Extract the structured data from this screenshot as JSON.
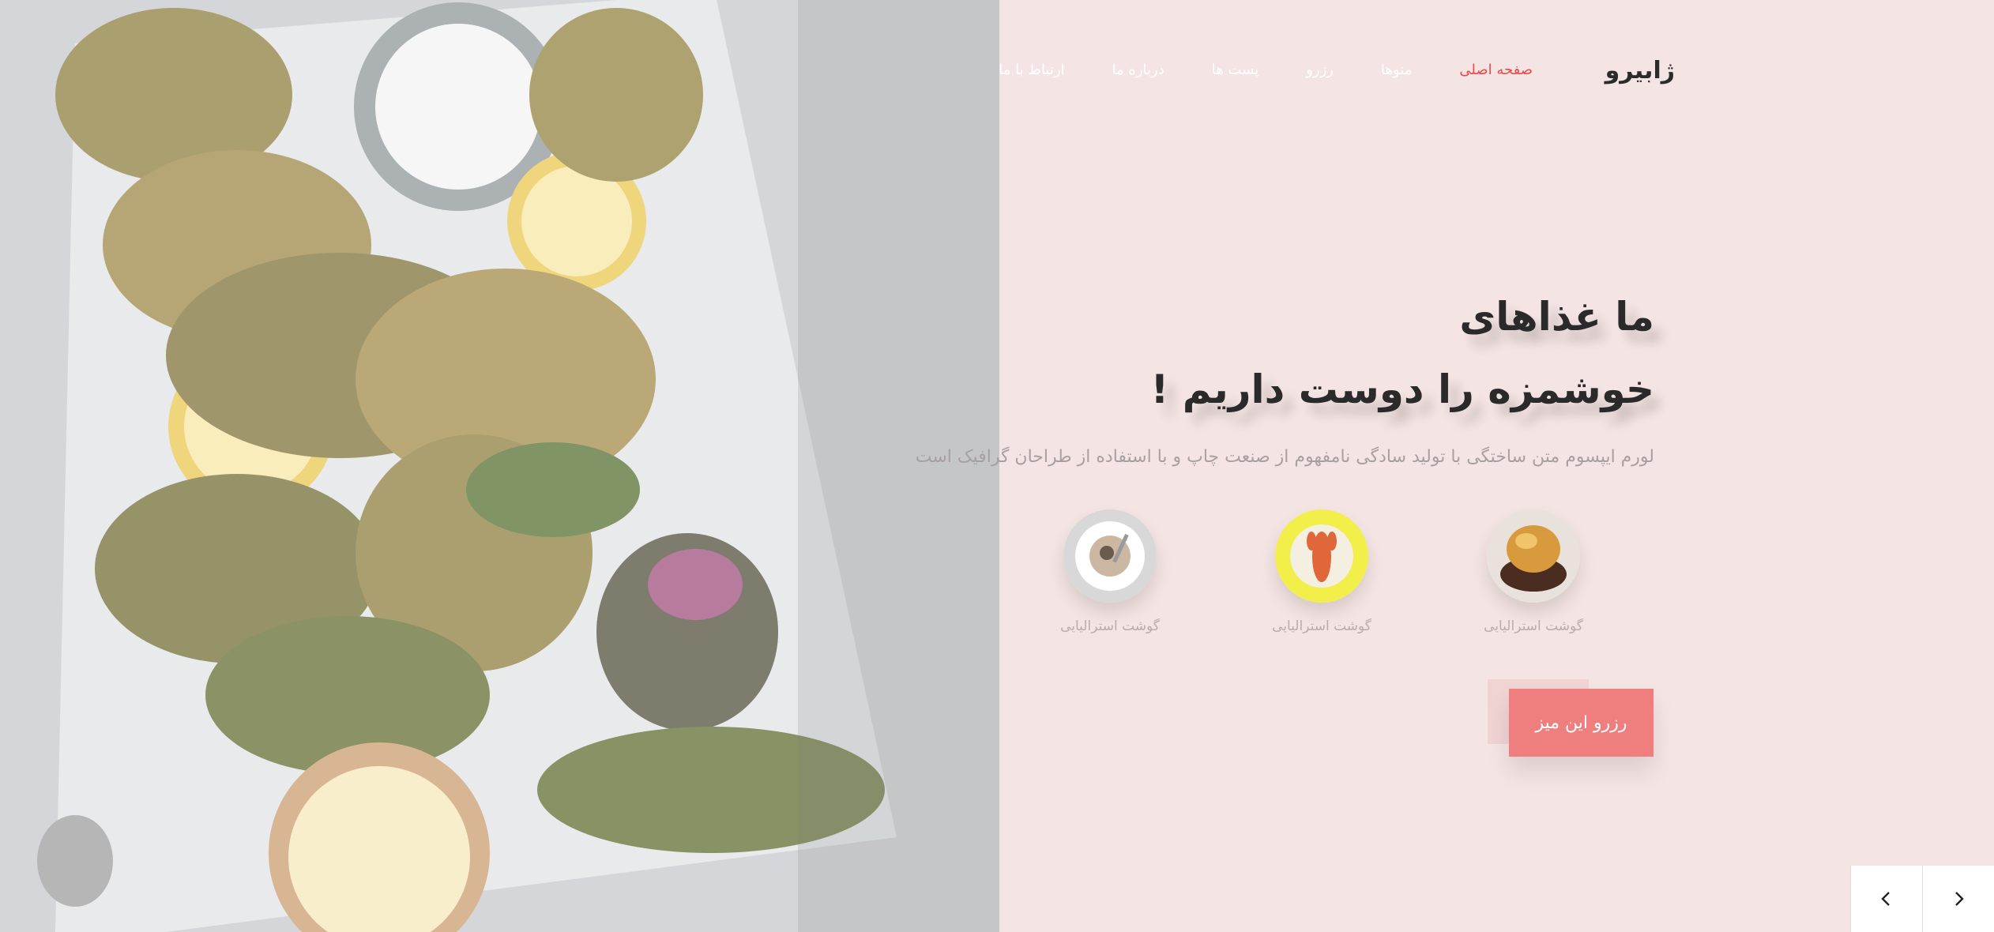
{
  "brand": {
    "logo": "ژابیرو"
  },
  "nav": {
    "items": [
      {
        "label": "صفحه اصلی",
        "active": true
      },
      {
        "label": "منوها",
        "active": false
      },
      {
        "label": "رزرو",
        "active": false
      },
      {
        "label": "پست ها",
        "active": false
      },
      {
        "label": "درباره ما",
        "active": false
      },
      {
        "label": "ارتباط با ما",
        "active": false
      }
    ]
  },
  "hero": {
    "title_line1": "ما غذاهای",
    "title_line2": "خوشمزه را دوست داریم !",
    "lead": "لورم ایپسوم متن ساختگی با تولید سادگی نامفهوم از صنعت چاپ و با استفاده از طراحان گرافیک است",
    "cta_label": "رزرو این میز"
  },
  "dishes": [
    {
      "caption": "گوشت استرالیایی",
      "icon": "fried-dish-image"
    },
    {
      "caption": "گوشت استرالیایی",
      "icon": "lobster-image"
    },
    {
      "caption": "گوشت استرالیایی",
      "icon": "pasta-plate-image"
    }
  ],
  "slider": {
    "prev_icon": "chevron-left-icon",
    "next_icon": "chevron-right-icon"
  },
  "colors": {
    "background": "#f5e4e4",
    "accent": "#ef7f7f",
    "active_nav": "#e94a4a",
    "heading": "#2a2a2a"
  }
}
